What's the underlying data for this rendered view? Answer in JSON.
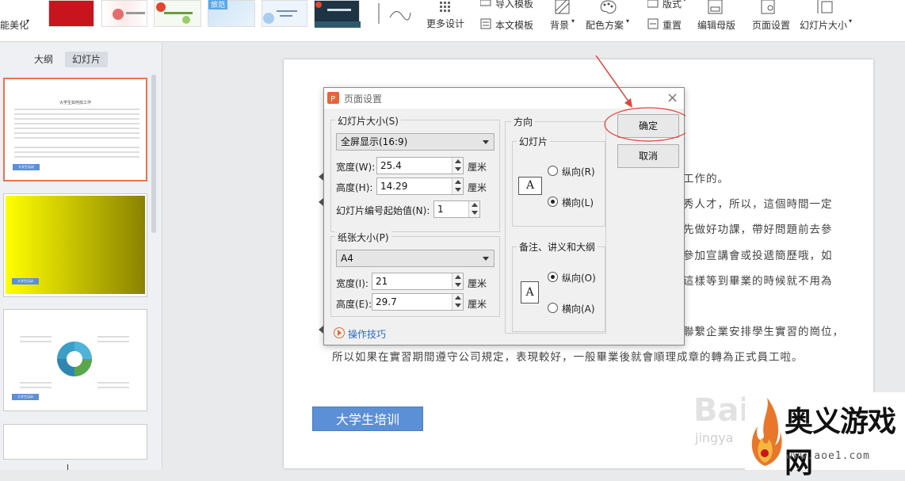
{
  "toolbar": {
    "beautify_label": "能美化",
    "more_design_label": "更多设计",
    "import_template_label": "导入模板",
    "text_template_label": "本文模板",
    "background_label": "背景",
    "color_scheme_label": "配色方案",
    "layout_label": "版式",
    "reset_label": "重置",
    "edit_master_label": "编辑母版",
    "page_setup_label": "页面设置",
    "slide_size_label": "幻灯片大小",
    "template_badge": "旅范"
  },
  "left_panel": {
    "tab_outline": "大纲",
    "tab_slides": "幻灯片",
    "thumb1_title": "大学生如何找工作",
    "thumb_button": "大学生培训"
  },
  "slide": {
    "lines": [
      "工作的。",
      "秀人才，所以，這個時間一定",
      "先做好功課，帶好問題前去參",
      "參加宣講會或投遞簡歷哦，如",
      "這樣等到畢業的時候就不用為",
      "聯繫企業安排學生實習的崗位，",
      "所以如果在實習期間遵守公司規定，表現較好，一般畢業後就會順理成章的轉為正式員工啦。"
    ],
    "button_label": "大学生培训",
    "watermark": "Bai",
    "watermark_sub": "jingya"
  },
  "site": {
    "name": "奥义游戏网",
    "url": "www.aoe1.com"
  },
  "dialog": {
    "title": "页面设置",
    "slide_size_group": "幻灯片大小(S)",
    "slide_size_value": "全屏显示(16:9)",
    "width_label": "宽度(W):",
    "width_value": "25.4",
    "height_label": "高度(H):",
    "height_value": "14.29",
    "unit": "厘米",
    "start_number_label": "幻灯片编号起始值(N):",
    "start_number_value": "1",
    "paper_group": "纸张大小(P)",
    "paper_value": "A4",
    "paper_width_label": "宽度(I):",
    "paper_width_value": "21",
    "paper_height_label": "高度(E):",
    "paper_height_value": "29.7",
    "orientation_label": "方向",
    "slides_group": "幻灯片",
    "portrait_r": "纵向(R)",
    "landscape_l": "横向(L)",
    "notes_group": "备注、讲义和大纲",
    "portrait_o": "纵向(O)",
    "landscape_a": "横向(A)",
    "ok_label": "确定",
    "cancel_label": "取消",
    "tips_label": "操作技巧",
    "page_icon_letter": "A"
  },
  "colors": {
    "accent_red": "#e0443a",
    "button_blue": "#5b8fd6",
    "thumb_yellow_start": "#ffff00",
    "thumb_yellow_end": "#8a8200"
  }
}
